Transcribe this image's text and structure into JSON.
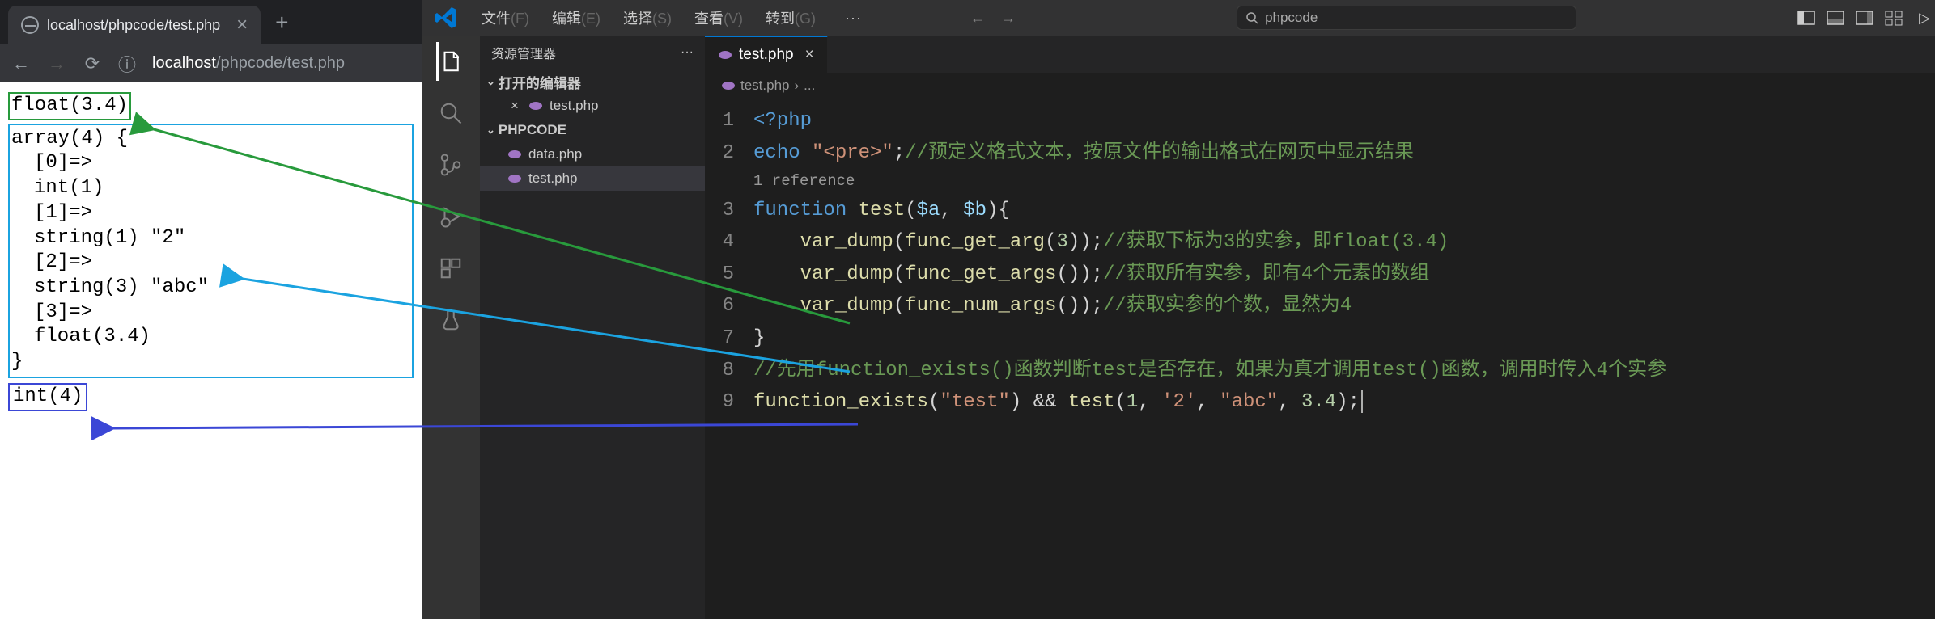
{
  "browser": {
    "tab_title": "localhost/phpcode/test.php",
    "url_host": "localhost",
    "url_path": "/phpcode/test.php",
    "output": {
      "line_float": "float(3.4)",
      "array_header": "array(4) {",
      "rows": [
        "[0]=>",
        "int(1)",
        "[1]=>",
        "string(1) \"2\"",
        "[2]=>",
        "string(3) \"abc\"",
        "[3]=>",
        "float(3.4)"
      ],
      "array_close": "}",
      "line_int": "int(4)"
    }
  },
  "vscode": {
    "menus": [
      {
        "label": "文件",
        "hint": "(F)"
      },
      {
        "label": "编辑",
        "hint": "(E)"
      },
      {
        "label": "选择",
        "hint": "(S)"
      },
      {
        "label": "查看",
        "hint": "(V)"
      },
      {
        "label": "转到",
        "hint": "(G)"
      }
    ],
    "search_text": "phpcode",
    "explorer": {
      "title": "资源管理器",
      "open_editors_label": "打开的编辑器",
      "project_label": "PHPCODE",
      "open_file": "test.php",
      "files": [
        "data.php",
        "test.php"
      ]
    },
    "tabs": {
      "test": "test.php"
    },
    "breadcrumb_file": "test.php",
    "breadcrumb_more": "...",
    "code": {
      "l1_open": "<?php",
      "l2_echo": "echo",
      "l2_str": "\"<pre>\"",
      "l2_com": "//预定义格式文本，按原文件的输出格式在网页中显示结果",
      "ref": "1 reference",
      "l3_kw": "function",
      "l3_name": "test",
      "l3_args_a": "$a",
      "l3_args_b": "$b",
      "l4_fn": "var_dump",
      "l4_call": "func_get_arg",
      "l4_num": "3",
      "l4_com": "//获取下标为3的实参，即float(3.4)",
      "l5_fn": "var_dump",
      "l5_call": "func_get_args",
      "l5_com": "//获取所有实参，即有4个元素的数组",
      "l6_fn": "var_dump",
      "l6_call": "func_num_args",
      "l6_com": "//获取实参的个数，显然为4",
      "l7_brace": "}",
      "l8_com": "//先用function_exists()函数判断test是否存在，如果为真才调用test()函数，调用时传入4个实参",
      "l9_fe": "function_exists",
      "l9_feArg": "\"test\"",
      "l9_call": "test",
      "l9_a1": "1",
      "l9_a2": "'2'",
      "l9_a3": "\"abc\"",
      "l9_a4": "3.4"
    }
  },
  "arrows": {
    "green": {
      "color": "#289a3c"
    },
    "cyan": {
      "color": "#1ba3e0"
    },
    "blue": {
      "color": "#3b47d6"
    }
  }
}
